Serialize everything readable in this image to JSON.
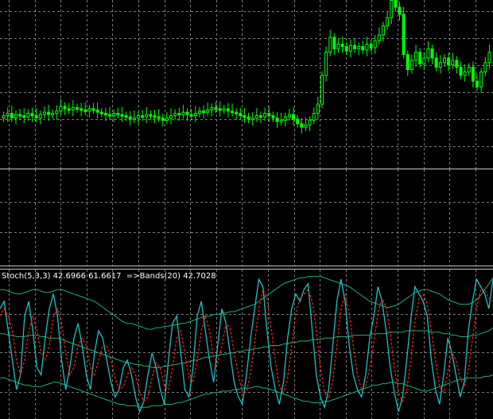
{
  "indicator_window": {
    "label": "Stoch(5,3,3) 42.6966 61.6617  =>Bands(20) 42.7028"
  },
  "colors": {
    "background": "#000000",
    "grid": "#7a7a7a",
    "candle": "#00ff00",
    "separator": "#c8c8c8",
    "stoch_main": "#20c0c0",
    "stoch_signal": "#ff2020",
    "bands": "#20b070",
    "label_text": "#ffffff"
  },
  "chart_data": [
    {
      "type": "candlestick",
      "series": [
        {
          "close": [
            1.0,
            1.2,
            0.8,
            1.1,
            1.0,
            0.9,
            1.2,
            1.0,
            0.8,
            1.1,
            1.3,
            1.1,
            1.2,
            1.4,
            1.8,
            1.6,
            1.5,
            1.7,
            1.6,
            1.5,
            1.4,
            1.6,
            1.5,
            1.3,
            1.2,
            1.1,
            1.0,
            1.2,
            1.1,
            1.0,
            0.9,
            0.7,
            0.8,
            1.0,
            0.9,
            1.1,
            1.0,
            0.9,
            0.8,
            0.6,
            0.8,
            1.0,
            1.2,
            1.1,
            1.3,
            1.1,
            1.0,
            1.2,
            1.4,
            1.3,
            1.5,
            1.7,
            1.6,
            1.5,
            1.6,
            1.4,
            1.3,
            1.2,
            1.0,
            0.9,
            0.7,
            0.8,
            1.0,
            0.9,
            1.2,
            1.0,
            0.8,
            0.5,
            0.6,
            0.9,
            1.1,
            0.7,
            0.3,
            0.0,
            0.2,
            0.6,
            1.2,
            2.0,
            4.5,
            6.5,
            7.8,
            6.8,
            7.2,
            7.0,
            6.6,
            7.1,
            6.8,
            7.0,
            6.7,
            7.2,
            6.9,
            7.5,
            8.0,
            8.8,
            9.5,
            11.0,
            10.4,
            9.8,
            6.3,
            5.0,
            5.8,
            6.5,
            5.5,
            6.0,
            6.8,
            6.0,
            5.2,
            5.6,
            6.0,
            5.4,
            5.8,
            5.2,
            4.5,
            4.8,
            5.2,
            4.0,
            3.5,
            4.8,
            5.6,
            6.5
          ]
        }
      ]
    },
    {
      "type": "line",
      "ylim": [
        0,
        100
      ],
      "series": [
        {
          "role": "main",
          "values": [
            75,
            80,
            60,
            40,
            20,
            30,
            70,
            80,
            60,
            35,
            30,
            55,
            75,
            85,
            70,
            40,
            20,
            35,
            55,
            65,
            50,
            30,
            20,
            45,
            60,
            55,
            40,
            25,
            15,
            20,
            35,
            40,
            30,
            15,
            5,
            12,
            30,
            45,
            35,
            20,
            10,
            40,
            65,
            70,
            45,
            20,
            15,
            35,
            70,
            80,
            60,
            40,
            25,
            50,
            75,
            65,
            45,
            25,
            15,
            10,
            30,
            55,
            75,
            95,
            90,
            60,
            35,
            20,
            10,
            25,
            55,
            75,
            85,
            80,
            88,
            92,
            60,
            30,
            15,
            8,
            20,
            50,
            80,
            95,
            80,
            50,
            30,
            20,
            15,
            30,
            55,
            70,
            90,
            80,
            60,
            35,
            18,
            5,
            15,
            40,
            68,
            90,
            85,
            80,
            70,
            40,
            20,
            10,
            30,
            55,
            45,
            30,
            15,
            25,
            60,
            80,
            95,
            90,
            85,
            75,
            95
          ]
        },
        {
          "role": "signal",
          "values": [
            70,
            75,
            70,
            60,
            40,
            30,
            40,
            60,
            70,
            60,
            45,
            40,
            50,
            70,
            75,
            65,
            45,
            30,
            35,
            50,
            55,
            50,
            35,
            30,
            40,
            50,
            50,
            40,
            28,
            20,
            22,
            30,
            35,
            30,
            18,
            12,
            15,
            28,
            38,
            35,
            22,
            20,
            35,
            55,
            60,
            45,
            28,
            25,
            40,
            60,
            70,
            60,
            42,
            38,
            50,
            65,
            62,
            45,
            30,
            18,
            18,
            32,
            52,
            75,
            88,
            82,
            62,
            40,
            22,
            18,
            28,
            50,
            72,
            82,
            85,
            88,
            80,
            60,
            35,
            18,
            14,
            26,
            50,
            75,
            85,
            72,
            50,
            30,
            20,
            22,
            35,
            52,
            72,
            82,
            76,
            58,
            35,
            18,
            12,
            20,
            40,
            66,
            82,
            85,
            78,
            60,
            40,
            22,
            18,
            32,
            45,
            40,
            28,
            22,
            33,
            55,
            75,
            88,
            88,
            82,
            80
          ]
        },
        {
          "role": "band",
          "values": [
            88,
            88,
            87,
            86,
            85,
            85,
            86,
            87,
            88,
            88,
            87,
            86,
            86,
            87,
            88,
            88,
            87,
            86,
            85,
            84,
            83,
            82,
            81,
            80,
            78,
            76,
            74,
            72,
            70,
            68,
            66,
            65,
            65,
            64,
            63,
            62,
            61,
            61,
            62,
            62,
            63,
            63,
            64,
            64,
            65,
            65,
            66,
            67,
            68,
            69,
            70,
            70,
            71,
            71,
            72,
            72,
            73,
            73,
            74,
            75,
            76,
            77,
            78,
            80,
            82,
            84,
            86,
            88,
            90,
            92,
            93,
            94,
            95,
            96,
            96,
            97,
            97,
            97,
            97,
            96,
            95,
            94,
            93,
            92,
            91,
            90,
            88,
            86,
            84,
            82,
            80,
            79,
            78,
            77,
            76,
            76,
            77,
            78,
            80,
            82,
            84,
            86,
            87,
            88,
            88,
            87,
            86,
            85,
            83,
            81,
            80,
            79,
            78,
            78,
            78,
            79,
            81,
            84,
            88,
            92,
            96
          ]
        },
        {
          "role": "band",
          "values": [
            58,
            58,
            57,
            57,
            56,
            56,
            56,
            57,
            57,
            57,
            56,
            56,
            55,
            55,
            55,
            54,
            53,
            52,
            51,
            50,
            49,
            48,
            47,
            46,
            45,
            44,
            43,
            42,
            41,
            40,
            39,
            38,
            38,
            37,
            37,
            36,
            36,
            35,
            35,
            35,
            36,
            36,
            37,
            37,
            38,
            38,
            39,
            40,
            40,
            41,
            42,
            42,
            43,
            43,
            44,
            44,
            45,
            45,
            46,
            46,
            47,
            47,
            48,
            48,
            49,
            49,
            50,
            50,
            50,
            51,
            51,
            52,
            52,
            53,
            53,
            53,
            54,
            54,
            54,
            55,
            55,
            55,
            56,
            56,
            56,
            56,
            57,
            57,
            57,
            57,
            57,
            58,
            58,
            58,
            58,
            59,
            59,
            59,
            59,
            60,
            60,
            60,
            60,
            60,
            60,
            59,
            59,
            59,
            58,
            58,
            57,
            57,
            56,
            56,
            56,
            57,
            57,
            58,
            59,
            60,
            62
          ]
        },
        {
          "role": "band",
          "values": [
            28,
            28,
            27,
            26,
            25,
            24,
            23,
            23,
            22,
            22,
            22,
            23,
            24,
            25,
            25,
            24,
            23,
            22,
            21,
            20,
            19,
            18,
            17,
            16,
            15,
            14,
            13,
            12,
            11,
            10,
            10,
            9,
            9,
            9,
            8,
            8,
            8,
            9,
            9,
            9,
            10,
            10,
            10,
            11,
            11,
            12,
            13,
            14,
            15,
            16,
            17,
            17,
            18,
            18,
            19,
            19,
            19,
            20,
            20,
            21,
            21,
            21,
            22,
            22,
            21,
            21,
            20,
            19,
            18,
            17,
            16,
            15,
            14,
            13,
            12,
            12,
            11,
            11,
            11,
            12,
            12,
            13,
            14,
            15,
            16,
            17,
            18,
            19,
            20,
            21,
            22,
            23,
            23,
            24,
            24,
            25,
            25,
            24,
            24,
            23,
            22,
            21,
            20,
            19,
            19,
            20,
            21,
            22,
            23,
            24,
            25,
            26,
            27,
            27,
            28,
            28,
            28,
            28,
            29,
            29,
            30
          ]
        }
      ]
    }
  ]
}
